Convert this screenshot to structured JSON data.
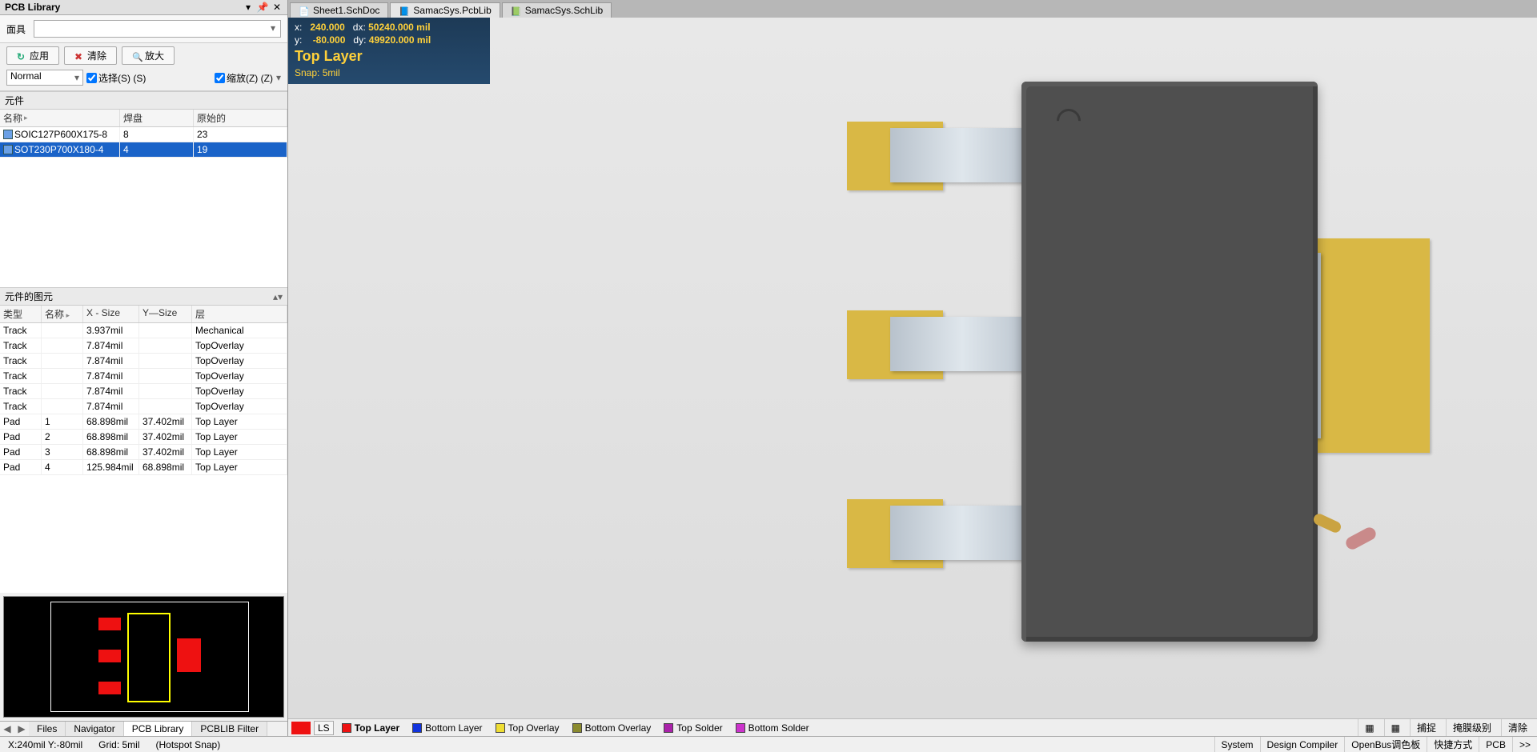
{
  "panel": {
    "title": "PCB Library",
    "mask_label": "面具",
    "buttons": {
      "apply": "应用",
      "clear": "清除",
      "zoom": "放大"
    },
    "filter": {
      "mode": "Normal",
      "select_label": "选择(S) (S)",
      "zoom_label": "缩放(Z) (Z)"
    },
    "components": {
      "header": "元件",
      "columns": {
        "name": "名称",
        "pads": "焊盘",
        "prims": "原始的"
      },
      "rows": [
        {
          "name": "SOIC127P600X175-8",
          "pads": "8",
          "prims": "23",
          "selected": false
        },
        {
          "name": "SOT230P700X180-4",
          "pads": "4",
          "prims": "19",
          "selected": true
        }
      ]
    },
    "primitives": {
      "header": "元件的图元",
      "columns": {
        "type": "类型",
        "name": "名称",
        "x": "X - Size",
        "y": "Y—Size",
        "layer": "层"
      },
      "rows": [
        {
          "type": "Track",
          "name": "",
          "x": "3.937mil",
          "y": "",
          "layer": "Mechanical"
        },
        {
          "type": "Track",
          "name": "",
          "x": "7.874mil",
          "y": "",
          "layer": "TopOverlay"
        },
        {
          "type": "Track",
          "name": "",
          "x": "7.874mil",
          "y": "",
          "layer": "TopOverlay"
        },
        {
          "type": "Track",
          "name": "",
          "x": "7.874mil",
          "y": "",
          "layer": "TopOverlay"
        },
        {
          "type": "Track",
          "name": "",
          "x": "7.874mil",
          "y": "",
          "layer": "TopOverlay"
        },
        {
          "type": "Track",
          "name": "",
          "x": "7.874mil",
          "y": "",
          "layer": "TopOverlay"
        },
        {
          "type": "Pad",
          "name": "1",
          "x": "68.898mil",
          "y": "37.402mil",
          "layer": "Top Layer"
        },
        {
          "type": "Pad",
          "name": "2",
          "x": "68.898mil",
          "y": "37.402mil",
          "layer": "Top Layer"
        },
        {
          "type": "Pad",
          "name": "3",
          "x": "68.898mil",
          "y": "37.402mil",
          "layer": "Top Layer"
        },
        {
          "type": "Pad",
          "name": "4",
          "x": "125.984mil",
          "y": "68.898mil",
          "layer": "Top Layer"
        }
      ]
    },
    "left_tabs": {
      "items": [
        "Files",
        "Navigator",
        "PCB Library",
        "PCBLIB Filter"
      ],
      "active": 2
    }
  },
  "doc_tabs": {
    "items": [
      {
        "label": "Sheet1.SchDoc",
        "icon": "sch",
        "active": false
      },
      {
        "label": "SamacSys.PcbLib",
        "icon": "pcb",
        "active": true
      },
      {
        "label": "SamacSys.SchLib",
        "icon": "lib",
        "active": false
      }
    ]
  },
  "hud": {
    "x_label": "x:",
    "x_val": "240.000",
    "dx_label": "dx:",
    "dx_val": "50240.000 mil",
    "y_label": "y:",
    "y_val": "-80.000",
    "dy_label": "dy:",
    "dy_val": "49920.000 mil",
    "layer": "Top Layer",
    "snap": "Snap: 5mil"
  },
  "layer_tabs": {
    "ls_label": "LS",
    "layers": [
      {
        "label": "Top Layer",
        "color": "#ee1111",
        "active": true
      },
      {
        "label": "Bottom Layer",
        "color": "#1133dd",
        "active": false
      },
      {
        "label": "Top Overlay",
        "color": "#eedd33",
        "active": false
      },
      {
        "label": "Bottom Overlay",
        "color": "#8a8a2e",
        "active": false
      },
      {
        "label": "Top Solder",
        "color": "#aa22aa",
        "active": false
      },
      {
        "label": "Bottom Solder",
        "color": "#cc33cc",
        "active": false
      }
    ],
    "right_icons": [
      "grid-icon",
      "snap-icon"
    ],
    "right_buttons": [
      "捕捉",
      "掩膜级别",
      "清除"
    ]
  },
  "status": {
    "coord": "X:240mil Y:-80mil",
    "grid": "Grid: 5mil",
    "hotspot": "(Hotspot Snap)",
    "right_buttons": [
      "System",
      "Design Compiler",
      "OpenBus调色板",
      "快捷方式",
      "PCB",
      ">>"
    ]
  }
}
